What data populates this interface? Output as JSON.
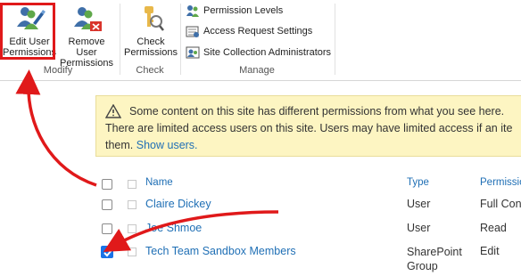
{
  "ribbon": {
    "edit_label": "Edit User\nPermissions",
    "remove_label": "Remove User\nPermissions",
    "check_label": "Check\nPermissions",
    "small_items": [
      "Permission Levels",
      "Access Request Settings",
      "Site Collection Administrators"
    ],
    "groups": {
      "modify": "Modify",
      "check": "Check",
      "manage": "Manage"
    }
  },
  "info_bar": {
    "line1": "Some content on this site has different permissions from what you see here.",
    "line2": "There are limited access users on this site. Users may have limited access if an ite",
    "line3_prefix": "them.",
    "show_users": "Show users."
  },
  "table": {
    "headers": {
      "name": "Name",
      "type": "Type",
      "permission": "Permissio"
    },
    "rows": [
      {
        "name": "Claire Dickey",
        "type": "User",
        "permission": "Full Con",
        "checked": false
      },
      {
        "name": "Joe Shmoe",
        "type": "User",
        "permission": "Read",
        "checked": false
      },
      {
        "name": "Tech Team Sandbox Members",
        "type": "SharePoint\nGroup",
        "permission": "Edit",
        "checked": true
      }
    ]
  },
  "colors": {
    "accent": "#1f6fb5",
    "annotation_red": "#e0191a",
    "info_bg": "#fdf5c2",
    "check_blue": "#1a73e8"
  }
}
